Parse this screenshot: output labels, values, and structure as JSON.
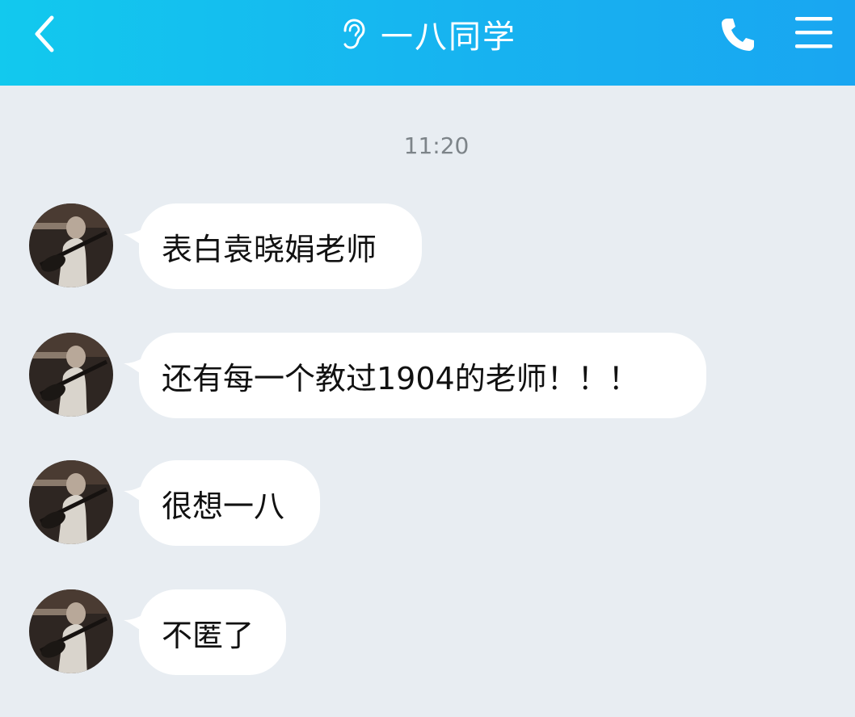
{
  "header": {
    "title": "一八同学",
    "background_start": "#12c9ee",
    "background_end": "#19a6f1",
    "icons": [
      "back-arrow-icon",
      "ear-icon",
      "phone-icon",
      "menu-icon"
    ]
  },
  "chat": {
    "timestamp": "11:20",
    "background": "#e8edf2",
    "messages": [
      {
        "text": "表白袁晓娟老师"
      },
      {
        "text": "还有每一个教过1904的老师！！！"
      },
      {
        "text": "很想一八"
      },
      {
        "text": "不匿了"
      }
    ]
  }
}
